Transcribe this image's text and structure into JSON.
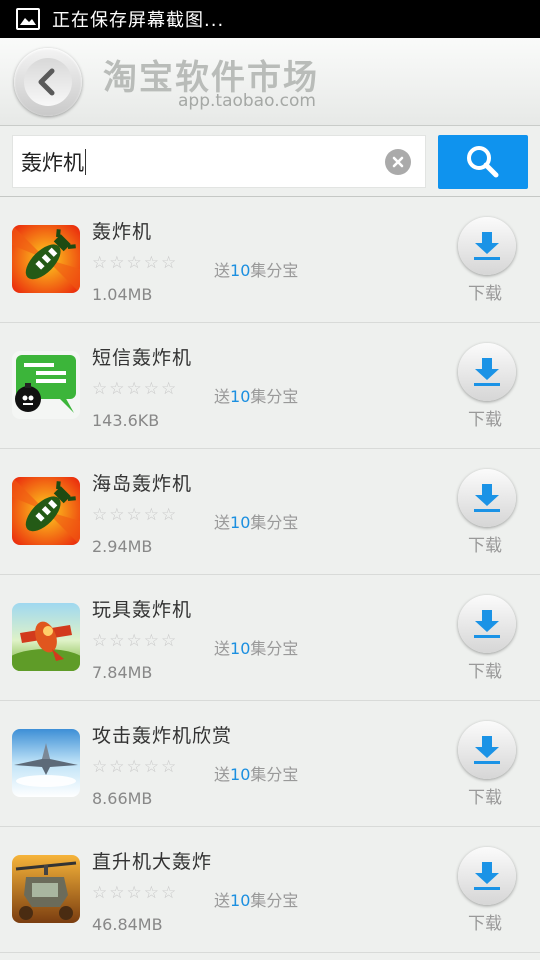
{
  "status_bar": {
    "text": "正在保存屏幕截图...",
    "icon": "image-icon"
  },
  "header": {
    "title": "淘宝软件市场",
    "subtitle": "app.taobao.com",
    "back_icon": "back-arrow-icon"
  },
  "search": {
    "value": "轰炸机",
    "clear_icon": "clear-icon",
    "button_icon": "search-icon"
  },
  "colors": {
    "accent": "#0f93ee",
    "promo_number": "#1b8fe0"
  },
  "apps": [
    {
      "name": "轰炸机",
      "rating": "☆☆☆☆☆",
      "promo_pre": "送",
      "promo_num": "10",
      "promo_post": "集分宝",
      "size": "1.04MB",
      "download": "下载",
      "icon": "bomb-icon"
    },
    {
      "name": "短信轰炸机",
      "rating": "☆☆☆☆☆",
      "promo_pre": "送",
      "promo_num": "10",
      "promo_post": "集分宝",
      "size": "143.6KB",
      "download": "下载",
      "icon": "sms-bomb-icon"
    },
    {
      "name": "海岛轰炸机",
      "rating": "☆☆☆☆☆",
      "promo_pre": "送",
      "promo_num": "10",
      "promo_post": "集分宝",
      "size": "2.94MB",
      "download": "下载",
      "icon": "bomb-icon"
    },
    {
      "name": "玩具轰炸机",
      "rating": "☆☆☆☆☆",
      "promo_pre": "送",
      "promo_num": "10",
      "promo_post": "集分宝",
      "size": "7.84MB",
      "download": "下载",
      "icon": "toy-plane-icon"
    },
    {
      "name": "攻击轰炸机欣赏",
      "rating": "☆☆☆☆☆",
      "promo_pre": "送",
      "promo_num": "10",
      "promo_post": "集分宝",
      "size": "8.66MB",
      "download": "下载",
      "icon": "jet-icon"
    },
    {
      "name": "直升机大轰炸",
      "rating": "☆☆☆☆☆",
      "promo_pre": "送",
      "promo_num": "10",
      "promo_post": "集分宝",
      "size": "46.84MB",
      "download": "下载",
      "icon": "helicopter-icon"
    }
  ]
}
